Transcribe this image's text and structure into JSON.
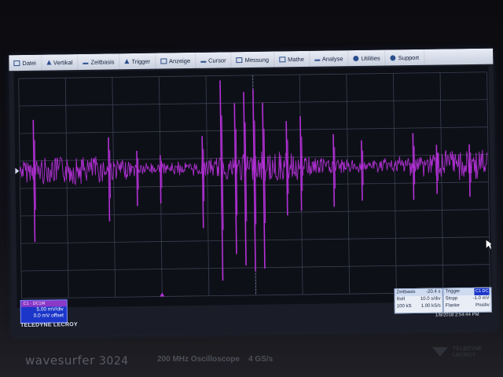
{
  "menu": {
    "items": [
      {
        "label": "Datei",
        "icon": "file-icon"
      },
      {
        "label": "Vertikal",
        "icon": "vertical-icon"
      },
      {
        "label": "Zeitbasis",
        "icon": "timebase-icon"
      },
      {
        "label": "Trigger",
        "icon": "trigger-icon"
      },
      {
        "label": "Anzeige",
        "icon": "display-icon"
      },
      {
        "label": "Cursor",
        "icon": "cursor-icon"
      },
      {
        "label": "Messung",
        "icon": "measure-icon"
      },
      {
        "label": "Mathe",
        "icon": "math-icon"
      },
      {
        "label": "Analyse",
        "icon": "analysis-icon"
      },
      {
        "label": "Utilities",
        "icon": "utilities-icon"
      },
      {
        "label": "Support",
        "icon": "support-icon"
      }
    ]
  },
  "channel": {
    "scale": "5.00 mV/div",
    "offset": "0.0 mV offset",
    "trace_color": "#b431d8",
    "badge_color": "#1b36c9"
  },
  "brand": "TELEDYNE LECROY",
  "timebase": {
    "label": "Zeitbasis",
    "value": "-20.4 s",
    "mode": "Roll",
    "div": "10.0 s/div",
    "samples": "100 kS",
    "rate": "1.00 kS/s"
  },
  "trigger": {
    "label": "Trigger",
    "badge": "C1 DC",
    "mode": "Stopp",
    "level": "-1.0 mV",
    "edge_label": "Flanke",
    "edge": "Positiv"
  },
  "datetime": "1/8/2018 2:54:44 PM",
  "device": {
    "model_name": "wavesurfer",
    "model_number": "3024",
    "bandwidth": "200 MHz Oscilloscope",
    "sample_rate": "4 GS/s",
    "logo_text_1": "TELEDYNE",
    "logo_text_2": "LECROY"
  },
  "waveform_spikes": [
    {
      "t": 0.03,
      "up": 0.55,
      "down": 0.62
    },
    {
      "t": 0.19,
      "up": 0.35,
      "down": 0.45
    },
    {
      "t": 0.25,
      "up": 0.2,
      "down": 0.32
    },
    {
      "t": 0.3,
      "up": 0.15,
      "down": 0.3
    },
    {
      "t": 0.39,
      "up": 0.35,
      "down": 0.52
    },
    {
      "t": 0.43,
      "up": 0.95,
      "down": 0.98
    },
    {
      "t": 0.46,
      "up": 0.7,
      "down": 0.75
    },
    {
      "t": 0.48,
      "up": 0.82,
      "down": 0.85
    },
    {
      "t": 0.5,
      "up": 0.85,
      "down": 0.9
    },
    {
      "t": 0.52,
      "up": 0.7,
      "down": 0.88
    },
    {
      "t": 0.57,
      "up": 0.5,
      "down": 0.42
    },
    {
      "t": 0.6,
      "up": 0.55,
      "down": 0.38
    },
    {
      "t": 0.67,
      "up": 0.35,
      "down": 0.35
    },
    {
      "t": 0.73,
      "up": 0.28,
      "down": 0.3
    },
    {
      "t": 0.84,
      "up": 0.35,
      "down": 0.3
    },
    {
      "t": 0.89,
      "up": 0.22,
      "down": 0.25
    },
    {
      "t": 0.96,
      "up": 0.22,
      "down": 0.28
    }
  ]
}
